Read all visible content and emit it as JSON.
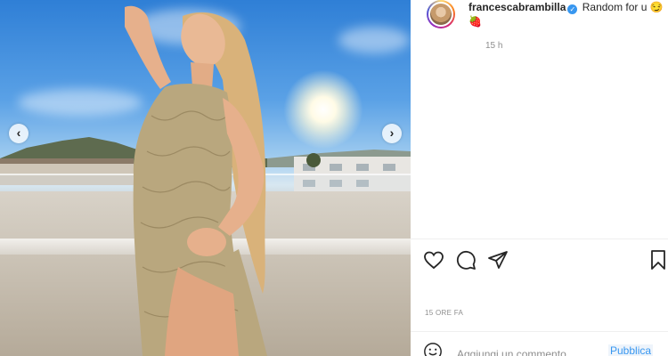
{
  "post": {
    "username": "francescabrambilla",
    "verified": true,
    "caption_text": "Random for u",
    "caption_emoji": "😏",
    "caption_emoji2": "🍓",
    "caption_time": "15 h",
    "timestamp": "15 ORE FA"
  },
  "icons": {
    "like": "heart-icon",
    "comment": "comment-icon",
    "share": "share-icon",
    "save": "bookmark-icon",
    "emoji": "smiley-icon",
    "prev": "chevron-left-icon",
    "next": "chevron-right-icon"
  },
  "nav": {
    "prev_glyph": "‹",
    "next_glyph": "›"
  },
  "comment_box": {
    "placeholder": "Aggiungi un commento...",
    "post_label": "Pubblica"
  },
  "colors": {
    "accent": "#3897f0",
    "text": "#262626",
    "muted": "#8e8e8e"
  }
}
